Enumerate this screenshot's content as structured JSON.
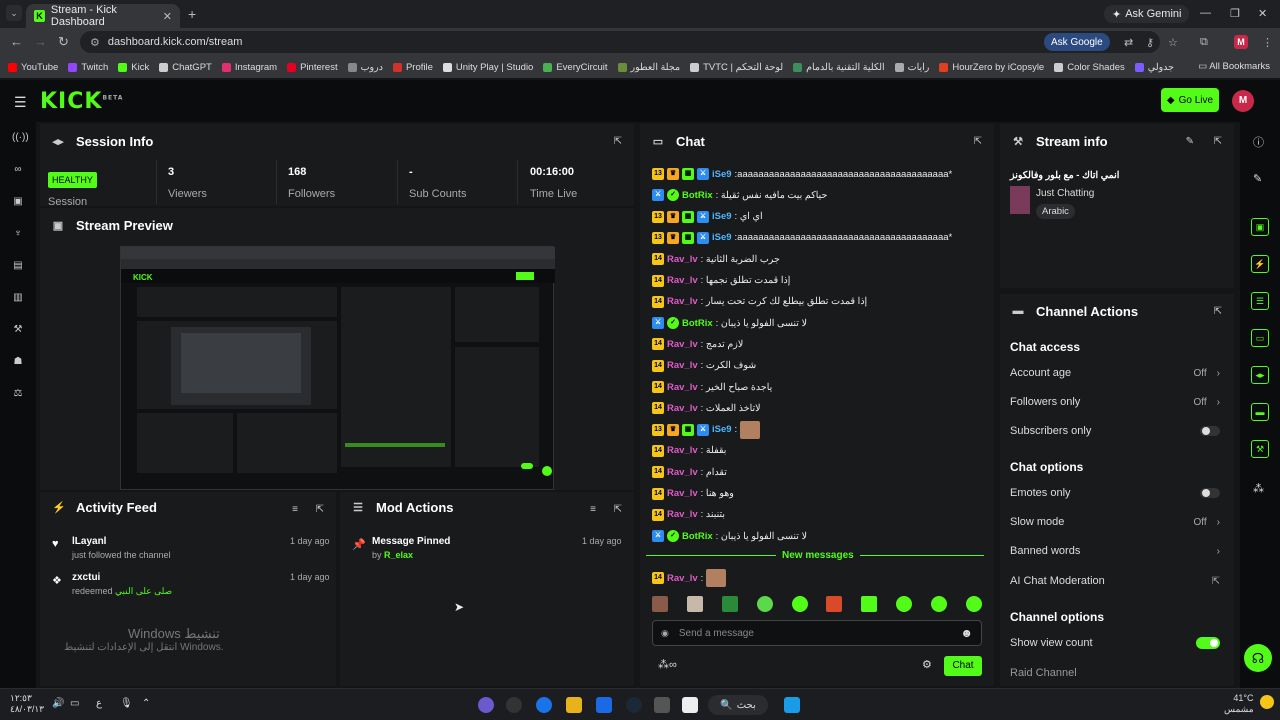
{
  "browser": {
    "tab_title": "Stream - Kick Dashboard",
    "gemini_label": "Ask Gemini",
    "url": "dashboard.kick.com/stream",
    "ask_google": "Ask Google",
    "profile_initial": "M",
    "bookmarks": [
      {
        "label": "YouTube",
        "color": "#ff0000"
      },
      {
        "label": "Twitch",
        "color": "#9146ff"
      },
      {
        "label": "Kick",
        "color": "#53fc18"
      },
      {
        "label": "ChatGPT",
        "color": "#cccccc"
      },
      {
        "label": "Instagram",
        "color": "#e1306c"
      },
      {
        "label": "Pinterest",
        "color": "#e60023"
      },
      {
        "label": "دروب",
        "color": "#888888"
      },
      {
        "label": "Profile",
        "color": "#d0312d"
      },
      {
        "label": "Unity Play | Studio",
        "color": "#dddddd"
      },
      {
        "label": "EveryCircuit",
        "color": "#4caf50"
      },
      {
        "label": "مجلة العطور",
        "color": "#6a8f3a"
      },
      {
        "label": "TVTC | لوحة التحكم",
        "color": "#cccccc"
      },
      {
        "label": "الكلية التقنية بالدمام",
        "color": "#3a8f5a"
      },
      {
        "label": "رايات",
        "color": "#aaaaaa"
      },
      {
        "label": "HourZero by iCopsyle",
        "color": "#e04020"
      },
      {
        "label": "Color Shades",
        "color": "#cccccc"
      },
      {
        "label": "جدولي",
        "color": "#7a5cff"
      }
    ],
    "all_bookmarks": "All Bookmarks"
  },
  "kick": {
    "logo": "KICK",
    "logo_sup": "BETA",
    "go_live": "Go Live",
    "avatar_initial": "M"
  },
  "session": {
    "title": "Session Info",
    "health": "HEALTHY",
    "health_label": "Session",
    "stats": [
      {
        "value": "3",
        "label": "Viewers"
      },
      {
        "value": "168",
        "label": "Followers"
      },
      {
        "value": "-",
        "label": "Sub Counts"
      },
      {
        "value": "00:16:00",
        "label": "Time Live"
      }
    ]
  },
  "preview": {
    "title": "Stream Preview"
  },
  "activity": {
    "title": "Activity Feed",
    "items": [
      {
        "name": "lLayanl",
        "sub": "just followed the channel",
        "time": "1 day ago",
        "icon": "heart"
      },
      {
        "name": "zxctui",
        "sub": "redeemed",
        "reward": "صلى على النبي",
        "time": "1 day ago",
        "icon": "gift"
      }
    ],
    "watermark_title": "Windows تنشيط",
    "watermark_sub": "انتقل إلى الإعدادات لتنشيط Windows."
  },
  "mod": {
    "title": "Mod Actions",
    "items": [
      {
        "action": "Message Pinned",
        "by_prefix": "by",
        "by": "R_elax",
        "time": "1 day ago"
      }
    ]
  },
  "chat": {
    "title": "Chat",
    "messages": [
      {
        "user": "iSe9",
        "cls": "u-ise",
        "badges": [
          "13",
          "crown",
          "grn",
          "blue"
        ],
        "text": ":aaaaaaaaaaaaaaaaaaaaaaaaaaaaaaaaaaaaaaaa*"
      },
      {
        "user": "BotRix",
        "cls": "u-bot",
        "badges": [
          "blue",
          "chk"
        ],
        "text": ": حياكم بيت مافيه نفس ثقيلة"
      },
      {
        "user": "iSe9",
        "cls": "u-ise",
        "badges": [
          "13",
          "crown",
          "grn",
          "blue"
        ],
        "text": ": اي اي"
      },
      {
        "user": "iSe9",
        "cls": "u-ise",
        "badges": [
          "13",
          "crown",
          "grn",
          "blue"
        ],
        "text": ":aaaaaaaaaaaaaaaaaaaaaaaaaaaaaaaaaaaaaaaa*"
      },
      {
        "user": "Rav_lv",
        "cls": "u-rav",
        "badges": [
          "14"
        ],
        "text": ": جرب الضربة الثانية"
      },
      {
        "user": "Rav_lv",
        "cls": "u-rav",
        "badges": [
          "14"
        ],
        "text": ": إذا قمدت تطلق نجمها"
      },
      {
        "user": "Rav_lv",
        "cls": "u-rav",
        "badges": [
          "14"
        ],
        "text": ": إذا قمدت تطلق بيطلع لك كرت تحت يسار"
      },
      {
        "user": "BotRix",
        "cls": "u-bot",
        "badges": [
          "blue",
          "chk"
        ],
        "text": ": لا تنسى الفولو يا ذيبان"
      },
      {
        "user": "Rav_lv",
        "cls": "u-rav",
        "badges": [
          "14"
        ],
        "text": ": لازم تدمج"
      },
      {
        "user": "Rav_lv",
        "cls": "u-rav",
        "badges": [
          "14"
        ],
        "text": ": شوف الكرت"
      },
      {
        "user": "Rav_lv",
        "cls": "u-rav",
        "badges": [
          "14"
        ],
        "text": ": ياجدة صباح الخير"
      },
      {
        "user": "Rav_lv",
        "cls": "u-rav",
        "badges": [
          "14"
        ],
        "text": ": لاتاخذ العملات"
      },
      {
        "user": "iSe9",
        "cls": "u-ise",
        "badges": [
          "13",
          "crown",
          "grn",
          "blue"
        ],
        "text": ":",
        "emote": true
      },
      {
        "user": "Rav_lv",
        "cls": "u-rav",
        "badges": [
          "14"
        ],
        "text": ": بقفلة"
      },
      {
        "user": "Rav_lv",
        "cls": "u-rav",
        "badges": [
          "14"
        ],
        "text": ": تقدام"
      },
      {
        "user": "Rav_lv",
        "cls": "u-rav",
        "badges": [
          "14"
        ],
        "text": ": وهو هنا"
      },
      {
        "user": "Rav_lv",
        "cls": "u-rav",
        "badges": [
          "14"
        ],
        "text": ": بتنبند"
      },
      {
        "user": "BotRix",
        "cls": "u-bot",
        "badges": [
          "blue",
          "chk"
        ],
        "text": ": لا تنسى الفولو يا ذيبان"
      }
    ],
    "new_messages": "New messages",
    "last": {
      "user": "Rav_lv",
      "cls": "u-rav",
      "badges": [
        "14"
      ],
      "text": ":",
      "emote": true
    },
    "placeholder": "Send a message",
    "send": "Chat"
  },
  "stream_info": {
    "title": "Stream info",
    "stream_title": "انمي اتاك - مع بلور وفالكونز",
    "category": "Just Chatting",
    "language": "Arabic"
  },
  "channel": {
    "title": "Channel Actions",
    "access_title": "Chat access",
    "account_age": {
      "label": "Account age",
      "value": "Off"
    },
    "followers_only": {
      "label": "Followers only",
      "value": "Off"
    },
    "subscribers_only": {
      "label": "Subscribers only",
      "on": false
    },
    "options_title": "Chat options",
    "emotes_only": {
      "label": "Emotes only",
      "on": false
    },
    "slow_mode": {
      "label": "Slow mode",
      "value": "Off"
    },
    "banned_words": {
      "label": "Banned words"
    },
    "ai_mod": {
      "label": "AI Chat Moderation"
    },
    "channel_options_title": "Channel options",
    "show_view_count": {
      "label": "Show view count",
      "on": true
    },
    "raid": {
      "label": "Raid Channel"
    }
  },
  "taskbar": {
    "clock_time": "١٢:٥٣",
    "clock_date": "٤٨/٠٣/١٣",
    "search": "بحث",
    "weather_temp": "41°C",
    "weather_desc": "مشمس",
    "lang": "ع"
  }
}
